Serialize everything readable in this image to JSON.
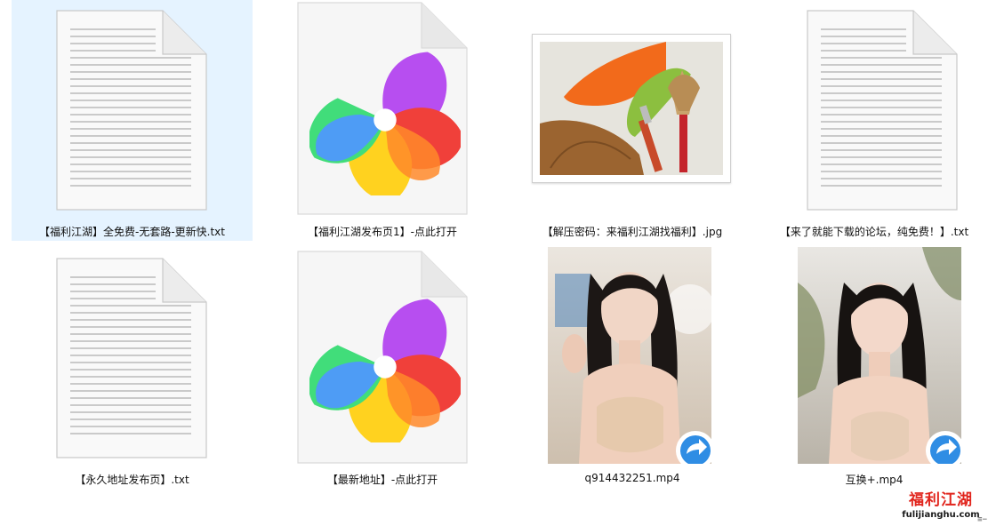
{
  "files": [
    {
      "name": "【福利江湖】全免费-无套路-更新快.txt",
      "type": "txt",
      "icon": "text-document-icon",
      "selected": true
    },
    {
      "name": "【福利江湖发布页1】-点此打开",
      "type": "url",
      "icon": "360-browser-document-icon"
    },
    {
      "name": "【解压密码：来福利江湖找福利】.jpg",
      "type": "jpg",
      "icon": "paint-brush-image-thumbnail"
    },
    {
      "name": "【来了就能下载的论坛，纯免费！】.txt",
      "type": "txt",
      "icon": "text-document-icon"
    },
    {
      "name": "【永久地址发布页】.txt",
      "type": "txt",
      "icon": "text-document-icon"
    },
    {
      "name": "【最新地址】-点此打开",
      "type": "url",
      "icon": "360-browser-document-icon"
    },
    {
      "name": "q914432251.mp4",
      "type": "mp4",
      "icon": "video-thumbnail"
    },
    {
      "name": "互换+.mp4",
      "type": "mp4",
      "icon": "video-thumbnail"
    }
  ],
  "watermark": {
    "title": "福利江湖",
    "url": "fulijianghu.com"
  },
  "corner_glyph": "≡−",
  "colors": {
    "selection": "#e5f3ff",
    "watermark_red": "#e1241c",
    "play_badge": "#2f8de4"
  }
}
